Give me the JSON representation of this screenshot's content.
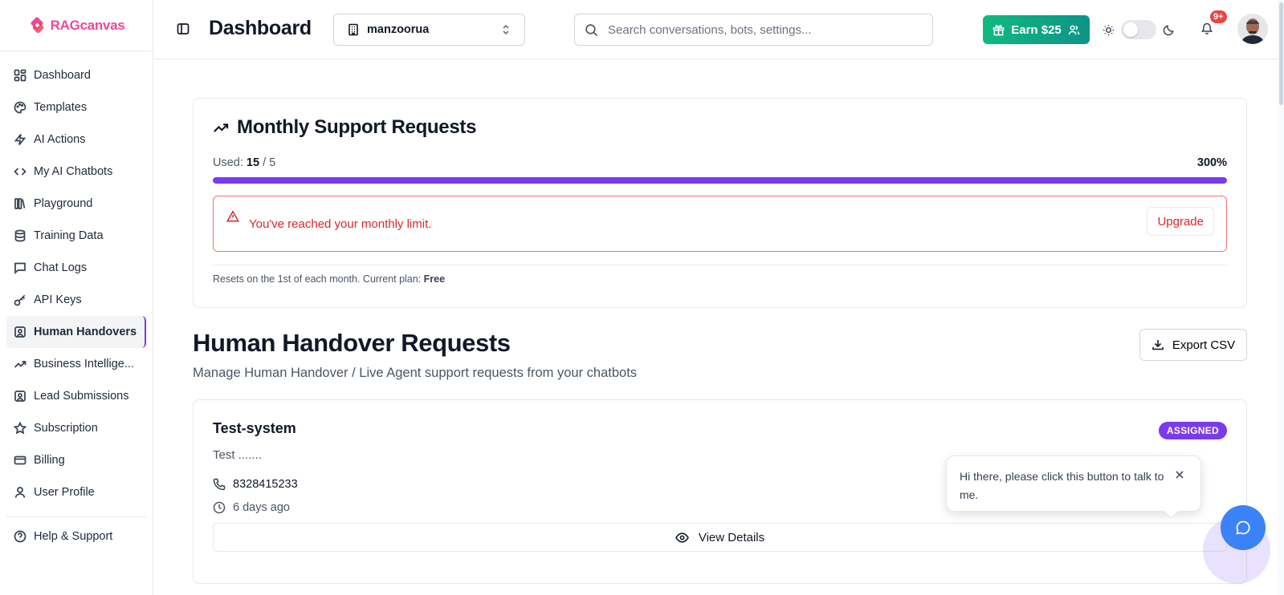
{
  "brand": {
    "name_part1": "RAG",
    "name_part2": "canvas",
    "color": "#ec4899"
  },
  "sidebar": {
    "items": [
      {
        "label": "Dashboard",
        "icon": "dashboard-icon"
      },
      {
        "label": "Templates",
        "icon": "palette-icon"
      },
      {
        "label": "AI Actions",
        "icon": "zap-icon"
      },
      {
        "label": "My AI Chatbots",
        "icon": "code-icon"
      },
      {
        "label": "Playground",
        "icon": "library-icon"
      },
      {
        "label": "Training Data",
        "icon": "database-icon"
      },
      {
        "label": "Chat Logs",
        "icon": "message-icon"
      },
      {
        "label": "API Keys",
        "icon": "key-icon"
      },
      {
        "label": "Human Handovers",
        "icon": "contact-icon",
        "active": true
      },
      {
        "label": "Business Intellige...",
        "icon": "trending-up-icon"
      },
      {
        "label": "Lead Submissions",
        "icon": "contact-icon"
      },
      {
        "label": "Subscription",
        "icon": "star-icon"
      },
      {
        "label": "Billing",
        "icon": "credit-card-icon"
      },
      {
        "label": "User Profile",
        "icon": "user-icon"
      }
    ],
    "footer_item": {
      "label": "Help & Support",
      "icon": "help-icon"
    }
  },
  "header": {
    "title": "Dashboard",
    "org_selector": "manzoorua",
    "search_placeholder": "Search conversations, bots, settings...",
    "earn_label": "Earn $25",
    "notification_count": "9+"
  },
  "usage": {
    "title": "Monthly Support Requests",
    "used_label": "Used:",
    "used": "15",
    "limit_sep": "/ 5",
    "percent_label": "300%",
    "progress_fraction": 1.0,
    "alert_text": "You've reached your monthly limit.",
    "upgrade_label": "Upgrade",
    "footer_text": "Resets on the 1st of each month. Current plan:",
    "plan": "Free"
  },
  "handovers": {
    "title": "Human Handover Requests",
    "subtitle": "Manage Human Handover / Live Agent support requests from your chatbots",
    "export_label": "Export CSV",
    "requests": [
      {
        "title": "Test-system",
        "status": "ASSIGNED",
        "description": "Test .......",
        "phone": "8328415233",
        "time": "6 days ago",
        "action_label": "View Details"
      }
    ]
  },
  "chat_widget": {
    "tooltip": "Hi there, please click this button to talk to me."
  },
  "colors": {
    "accent": "#7c3aed",
    "alert": "#dc2626",
    "earn": "#10b981",
    "chat": "#3b82f6"
  }
}
